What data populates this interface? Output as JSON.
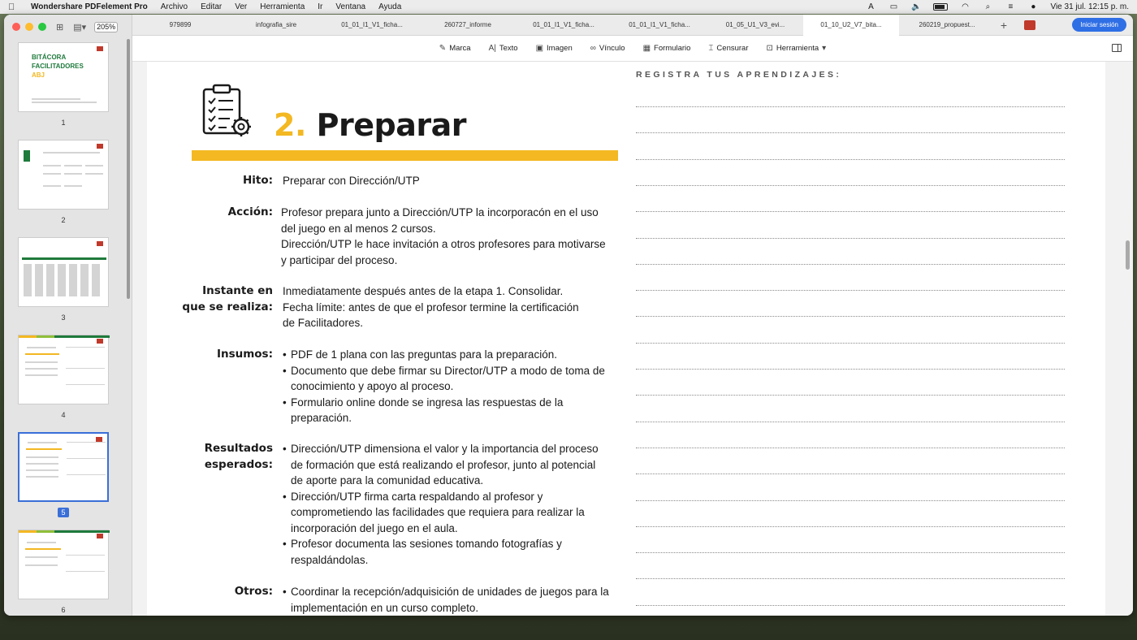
{
  "menubar": {
    "app_name": "Wondershare PDFelement Pro",
    "menus": [
      "Archivo",
      "Editar",
      "Ver",
      "Herramienta",
      "Ir",
      "Ventana",
      "Ayuda"
    ],
    "date_time": "Vie 31 jul.  12:15 p. m."
  },
  "sidebar": {
    "zoom": "205%",
    "pages": [
      {
        "num": "1",
        "title_lines": [
          "BITÁCORA",
          "FACILITADORES",
          "ABJ"
        ]
      },
      {
        "num": "2"
      },
      {
        "num": "3"
      },
      {
        "num": "4"
      },
      {
        "num": "5",
        "selected": true
      },
      {
        "num": "6"
      }
    ]
  },
  "tabs": [
    "979899",
    "infografia_sire",
    "01_01_I1_V1_ficha...",
    "260727_informe",
    "01_01_I1_V1_ficha...",
    "01_01_I1_V1_ficha...",
    "01_05_U1_V3_evi...",
    "01_10_U2_V7_bita...",
    "260219_propuest..."
  ],
  "active_tab_index": 7,
  "login_label": "Iniciar sesión",
  "toolbar": {
    "marca": "Marca",
    "texto": "Texto",
    "imagen": "Imagen",
    "vinculo": "Vínculo",
    "formulario": "Formulario",
    "censurar": "Censurar",
    "herramienta": "Herramienta"
  },
  "document": {
    "section_number": "2.",
    "section_title": "Preparar",
    "aprendizajes_title": "REGISTRA TUS APRENDIZAJES:",
    "fields": {
      "hito_label": "Hito:",
      "hito_value": "Preparar con Dirección/UTP",
      "accion_label": "Acción:",
      "accion_lines": [
        "Profesor prepara junto a Dirección/UTP la incorporacón en el  uso",
        "del juego en al menos 2 cursos.",
        "Dirección/UTP le hace invitación a otros profesores para motivarse",
        "y participar del proceso."
      ],
      "instante_label_1": "Instante en",
      "instante_label_2": "que se realiza:",
      "instante_lines": [
        "Inmediatamente después antes de la etapa 1. Consolidar.",
        "Fecha límite: antes de que el profesor termine la certificación",
        "de Facilitadores."
      ],
      "insumos_label": "Insumos:",
      "insumos_items": [
        [
          "PDF de 1 plana con las preguntas para la preparación."
        ],
        [
          "Documento que debe firmar su Director/UTP a modo de toma de",
          "conocimiento y apoyo al proceso."
        ],
        [
          "Formulario online donde se ingresa las respuestas de la",
          "preparación."
        ]
      ],
      "resultados_label_1": "Resultados",
      "resultados_label_2": "esperados:",
      "resultados_items": [
        [
          "Dirección/UTP dimensiona el valor y la importancia del proceso",
          "de formación que está realizando el profesor, junto al potencial",
          "de aporte para la comunidad educativa."
        ],
        [
          "Dirección/UTP firma carta respaldando al profesor y",
          "comprometiendo las facilidades que requiera para realizar la",
          "incorporación del juego en el aula."
        ],
        [
          "Profesor documenta las sesiones tomando fotografías y",
          "respaldándolas."
        ]
      ],
      "otros_label": "Otros:",
      "otros_items": [
        [
          "Coordinar la recepción/adquisición de unidades de juegos para la",
          "implementación en un curso completo."
        ]
      ]
    }
  }
}
